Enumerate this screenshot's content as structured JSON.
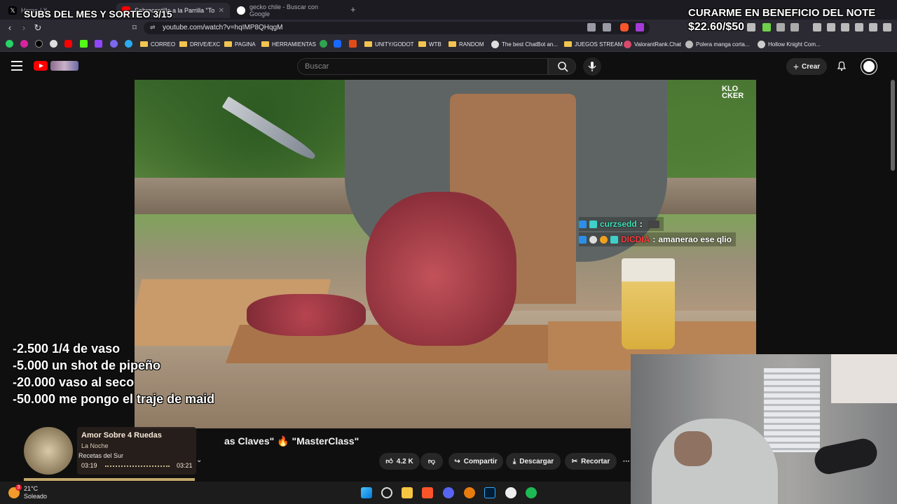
{
  "browser": {
    "tabs": [
      {
        "label": "Home / X",
        "favicon": "x-icon"
      },
      {
        "label": "Sobrecostilla a la Parrilla \"Todas las...",
        "favicon": "youtube-icon"
      },
      {
        "label": "gecko chile - Buscar con Google",
        "favicon": "google-icon"
      }
    ],
    "new_tab": "+",
    "url": "youtube.com/watch?v=hqIMP8QHqgM",
    "bookmarks": [
      "CORREO",
      "DRIVE/EXC",
      "PAGINA",
      "HERRAMIENTAS",
      "UNITY/GODOT",
      "WTB",
      "RANDOM",
      "The best ChatBot an...",
      "JUEGOS STREAM",
      "ValorantRank.Chat",
      "Polera manga corta...",
      "Hollow Knight Com..."
    ]
  },
  "youtube": {
    "search_placeholder": "Buscar",
    "create_label": "Crear",
    "video_title_fragment": "as Claves\" 🔥 \"MasterClass\"",
    "like_count": "4.2 K",
    "share_label": "Compartir",
    "download_label": "Descargar",
    "clip_label": "Recortar",
    "more_label": "···",
    "watermark_line1": "KLO",
    "watermark_line2": "CKER"
  },
  "chat": [
    {
      "user": "curzsedd",
      "sep": ":",
      "message": ""
    },
    {
      "user": "DICDIA",
      "sep": ":",
      "message": "amanerao ese qlio"
    }
  ],
  "overlays": {
    "subs_goal": "SUBS DEL MES Y SORTEO 3/15",
    "donation_goal_title": "CURARME EN BENEFICIO DEL NOTE",
    "donation_goal_amount": "$22.60/$50",
    "donations": [
      "-2.500  1/4 de vaso",
      "-5.000 un shot de pipeño",
      "-20.000  vaso al seco",
      "-50.000 me pongo el traje de maid"
    ]
  },
  "music": {
    "title": "Amor Sobre 4 Ruedas",
    "artist": "La Noche",
    "channel_overlap": "Recetas del Sur",
    "elapsed": "03:19",
    "total": "03:21",
    "progress": 0.99
  },
  "taskbar": {
    "temperature": "21°C",
    "condition": "Soleado",
    "notification_count": "3"
  },
  "colors": {
    "yt_red": "#ff0000",
    "chat_user1": "#3fe0b8",
    "chat_user2": "#ff3b3b",
    "folder": "#f2c450"
  }
}
